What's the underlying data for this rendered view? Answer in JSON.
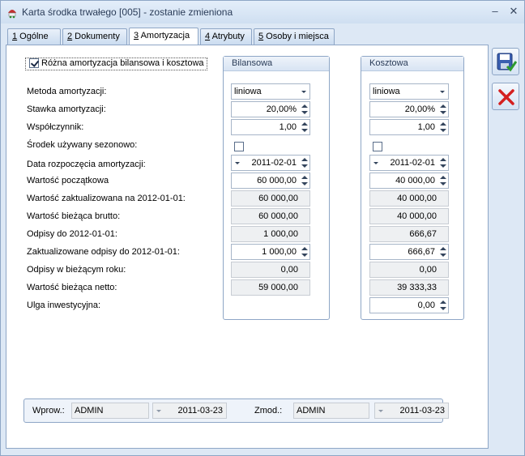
{
  "window": {
    "title": "Karta środka trwałego [005] - zostanie zmieniona",
    "min_glyph": "–",
    "close_glyph": "✕"
  },
  "tabs": [
    {
      "num": "1",
      "label": " Ogólne",
      "active": false
    },
    {
      "num": "2",
      "label": " Dokumenty",
      "active": false
    },
    {
      "num": "3",
      "label": " Amortyzacja",
      "active": true
    },
    {
      "num": "4",
      "label": " Atrybuty",
      "active": false
    },
    {
      "num": "5",
      "label": " Osoby i miejsca",
      "active": false
    }
  ],
  "main": {
    "diff_checkbox": {
      "label": "Różna amortyzacja bilansowa i kosztowa",
      "checked": true
    },
    "col_bilansowa": "Bilansowa",
    "col_kosztowa": "Kosztowa",
    "rows": {
      "metoda": {
        "label": "Metoda amortyzacji:",
        "bil": "liniowa",
        "kosz": "liniowa"
      },
      "stawka": {
        "label": "Stawka amortyzacji:",
        "bil": "20,00%",
        "kosz": "20,00%"
      },
      "wspolczynnik": {
        "label": "Współczynnik:",
        "bil": "1,00",
        "kosz": "1,00"
      },
      "sezonowo": {
        "label": "Środek używany sezonowo:",
        "bil_checked": false,
        "kosz_checked": false
      },
      "data_rozp": {
        "label": "Data rozpoczęcia amortyzacji:",
        "bil": "2011-02-01",
        "kosz": "2011-02-01"
      },
      "wart_pocz": {
        "label": "Wartość początkowa",
        "bil": "60 000,00",
        "kosz": "40 000,00"
      },
      "wart_zakt": {
        "label": "Wartość zaktualizowana na 2012-01-01:",
        "bil": "60 000,00",
        "kosz": "40 000,00"
      },
      "wart_biez_brutto": {
        "label": "Wartość bieżąca brutto:",
        "bil": "60 000,00",
        "kosz": "40 000,00"
      },
      "odpisy": {
        "label": "Odpisy do 2012-01-01:",
        "bil": "1 000,00",
        "kosz": "666,67"
      },
      "zakt_odpisy": {
        "label": "Zaktualizowane odpisy do 2012-01-01:",
        "bil": "1 000,00",
        "kosz": "666,67"
      },
      "odpisy_biez": {
        "label": "Odpisy w bieżącym roku:",
        "bil": "0,00",
        "kosz": "0,00"
      },
      "wart_biez_netto": {
        "label": "Wartość bieżąca netto:",
        "bil": "59 000,00",
        "kosz": "39 333,33"
      },
      "ulga": {
        "label": "Ulga inwestycyjna:",
        "kosz": "0,00"
      }
    }
  },
  "footer": {
    "wprow_label": "Wprow.:",
    "wprow_user": "ADMIN",
    "wprow_date": "2011-03-23",
    "zmod_label": "Zmod.:",
    "zmod_user": "ADMIN",
    "zmod_date": "2011-03-23"
  },
  "side_buttons": {
    "save_icon": "save-icon",
    "cancel_icon": "cancel-icon"
  },
  "colors": {
    "window_bg": "#dde8f5",
    "border": "#8ea6c6",
    "cancel_red": "#d42020",
    "save_blue": "#3a5fb0"
  }
}
